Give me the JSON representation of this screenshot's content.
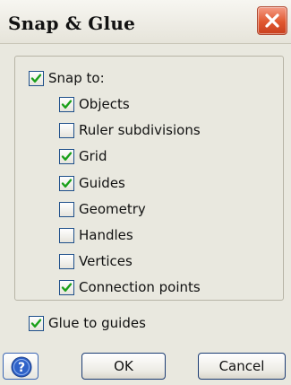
{
  "window": {
    "title": "Snap & Glue"
  },
  "options": {
    "snap_to": {
      "label": "Snap to:",
      "checked": true
    },
    "items": [
      {
        "label": "Objects",
        "checked": true
      },
      {
        "label": "Ruler subdivisions",
        "checked": false
      },
      {
        "label": "Grid",
        "checked": true
      },
      {
        "label": "Guides",
        "checked": true
      },
      {
        "label": "Geometry",
        "checked": false
      },
      {
        "label": "Handles",
        "checked": false
      },
      {
        "label": "Vertices",
        "checked": false
      },
      {
        "label": "Connection points",
        "checked": true
      }
    ],
    "glue_to_guides": {
      "label": "Glue to guides",
      "checked": true
    }
  },
  "buttons": {
    "ok_label": "OK",
    "cancel_label": "Cancel"
  },
  "icons": {
    "close": "close-icon",
    "help": "help-icon",
    "check": "checkmark-icon"
  },
  "colors": {
    "checkmark": "#1aa01a",
    "close_button": "#e0582f",
    "help_button": "#2f62c8"
  }
}
